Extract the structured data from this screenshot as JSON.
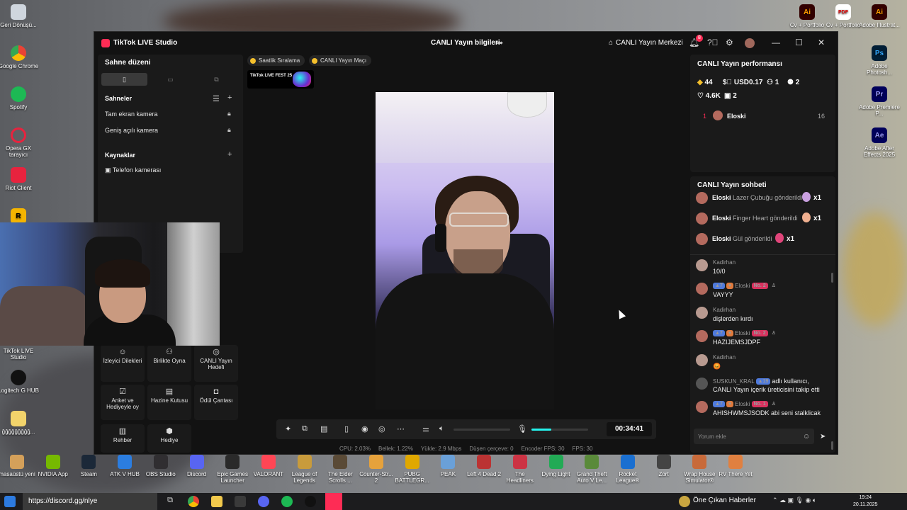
{
  "window": {
    "app_title": "TikTok LIVE Studio",
    "live_info": "CANLI Yayın bilgileri",
    "live_center": "CANLI Yayın Merkezi",
    "notification_count": "8"
  },
  "left_panel": {
    "title": "Sahne düzeni",
    "scenes_title": "Sahneler",
    "scenes": [
      "Tam ekran kamera",
      "Geniş açılı kamera"
    ],
    "sources_title": "Kaynaklar",
    "sources": [
      "Telefon kamerası"
    ]
  },
  "tools": [
    {
      "label": "İzleyici Dilekleri",
      "icon": "viewer-requests-icon"
    },
    {
      "label": "Birlikte Oyna",
      "icon": "play-together-icon"
    },
    {
      "label": "CANLI Yayın Hedefi",
      "icon": "live-goal-icon"
    },
    {
      "label": "Anket ve Hediyeyle oy",
      "icon": "poll-icon"
    },
    {
      "label": "Hazine Kutusu",
      "icon": "treasure-box-icon"
    },
    {
      "label": "Ödül Çantası",
      "icon": "reward-bag-icon"
    },
    {
      "label": "Rehber",
      "icon": "guide-icon"
    },
    {
      "label": "Hediye",
      "icon": "gift-icon"
    }
  ],
  "center": {
    "chip_ranking": "Saatlik Sıralama",
    "chip_match": "CANLI Yayın Maçı",
    "fest_label": "TikTok LIVE FEST 25",
    "timer": "00:34:41",
    "mic_level": 0.35,
    "volume_level": 0
  },
  "status": {
    "cpu": "CPU: 2.03%",
    "memory": "Bellek: 1.22%",
    "upload": "Yükle: 2.9 Mbps",
    "dropped": "Düşen çerçeve: 0",
    "encoder_fps": "Encoder FPS: 30",
    "fps": "FPS: 30"
  },
  "performance": {
    "title": "CANLI Yayın performansı",
    "diamonds": "44",
    "usd": "USD0.17",
    "viewers": "1",
    "users": "2",
    "likes": "4.6K",
    "shares": "2",
    "ranking": [
      {
        "rank": "1",
        "name": "Eloski",
        "score": "16"
      }
    ]
  },
  "chat": {
    "title": "CANLI Yayın sohbeti",
    "gifts": [
      {
        "name": "Eloski",
        "text": "Lazer Çubuğu gönderildi",
        "count": "x1",
        "color": "#c9a0e0"
      },
      {
        "name": "Eloski",
        "text": "Finger Heart gönderildi",
        "count": "x1",
        "color": "#f0b090"
      },
      {
        "name": "Eloski",
        "text": "Gül gönderildi",
        "count": "x1",
        "color": "#e0457a"
      }
    ],
    "messages": [
      {
        "user": "Kadirhan",
        "text": "10/0",
        "badges": false
      },
      {
        "user": "Eloski",
        "text": "VAYYY",
        "badges": true,
        "level": "7",
        "no": "No. 2"
      },
      {
        "user": "Kadirhan",
        "text": "dişlerden kırdı",
        "badges": false
      },
      {
        "user": "Eloski",
        "text": "HAZIJEMSJDPF",
        "badges": true,
        "level": "7",
        "no": "No. 2"
      },
      {
        "user": "Kadirhan",
        "text": "😡",
        "badges": false
      },
      {
        "user": "SUSKUN_KRAL",
        "level": "19",
        "text_inline": "adlı kullanıcı,",
        "text": "CANLI Yayın içerik üreticisini takip etti",
        "badges": false
      },
      {
        "user": "Eloski",
        "text": "AHISHWMSJSODK abi seni stalklicak",
        "badges": true,
        "level": "7",
        "no": "No. 1"
      }
    ],
    "comment_placeholder": "Yorum ekle"
  },
  "desktop_left": [
    "Geri Dönüşü...",
    "Google Chrome",
    "Spotify",
    "Opera GX tarayıcı",
    "Riot Client",
    "TikTok LIVE Studio",
    "Logitech G HUB",
    "ğğğğğğğğğ..."
  ],
  "desktop_right": [
    "Cv + Portfolio",
    "Adobe Illustrat...",
    "Adobe Photosh...",
    "Adobe Premiere P...",
    "Adobe After Effects 2025"
  ],
  "dock": [
    "masaüstü yeni",
    "NVIDIA App",
    "Steam",
    "ATK V HUB",
    "OBS Studio",
    "Discord",
    "Epic Games Launcher",
    "VALORANT",
    "League of Legends",
    "The Elder Scrolls ...",
    "Counter-Str... 2",
    "PUBG BATTLEGR...",
    "PEAK",
    "Left 4 Dead 2",
    "The Headliners",
    "Dying Light",
    "Grand Theft Auto V Le...",
    "Rocket League®",
    "Zort",
    "Wrap House Simulator®",
    "RV There Yet"
  ],
  "taskbar": {
    "url": "https://discord.gg/nlye",
    "news": "Öne Çıkan Haberler",
    "time": "19:24",
    "date": "20.11.2025"
  }
}
